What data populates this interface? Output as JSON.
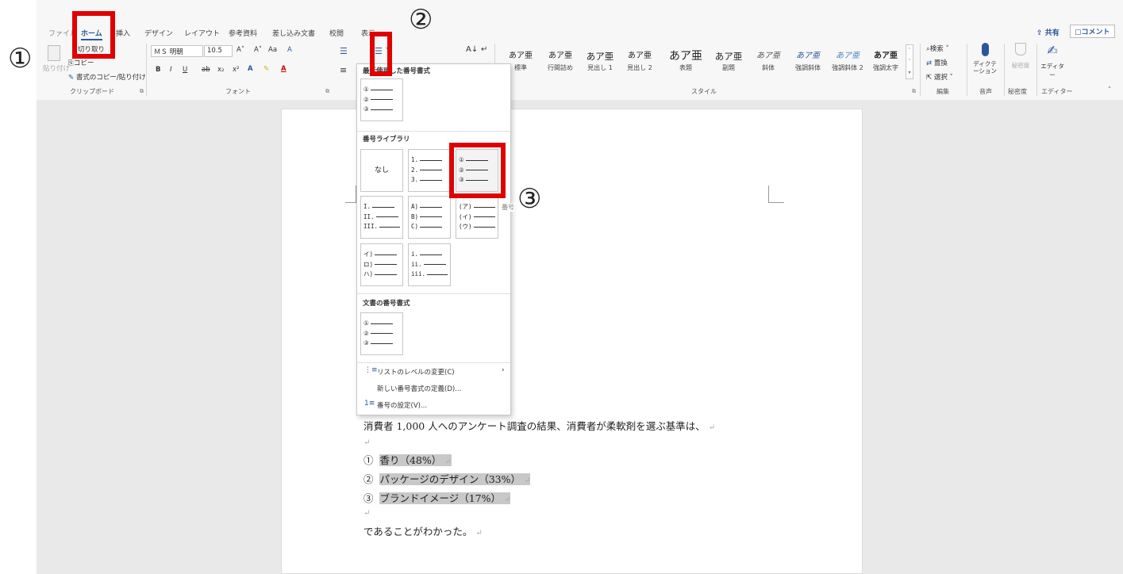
{
  "ribbon": {
    "tabs": [
      "ファイル",
      "ホーム",
      "挿入",
      "デザイン",
      "レイアウト",
      "参考資料",
      "差し込み文書",
      "校閲",
      "表示"
    ],
    "clipboard": {
      "paste": "貼り付け",
      "cut": "切り取り",
      "copy": "コピー",
      "format_painter": "書式のコピー/貼り付け",
      "label": "クリップボード"
    },
    "font": {
      "name": "ＭＳ 明朝",
      "size": "10.5",
      "label": "フォント",
      "grow": "A˄",
      "shrink": "A˅",
      "case": "Aa",
      "clear": "A",
      "bold": "B",
      "italic": "I",
      "underline": "U",
      "strike": "ab",
      "sub": "x₂",
      "sup": "x²"
    },
    "styles": {
      "items": [
        {
          "preview": "あア亜",
          "name": "標準"
        },
        {
          "preview": "あア亜",
          "name": "行間詰め"
        },
        {
          "preview": "あア亜",
          "name": "見出し 1"
        },
        {
          "preview": "あア亜",
          "name": "見出し 2"
        },
        {
          "preview": "あア亜",
          "name": "表題"
        },
        {
          "preview": "あア亜",
          "name": "副題"
        },
        {
          "preview": "あア亜",
          "name": "斜体"
        },
        {
          "preview": "あア亜",
          "name": "強調斜体"
        },
        {
          "preview": "あア亜",
          "name": "強調斜体 2"
        },
        {
          "preview": "あア亜",
          "name": "強調太字"
        }
      ],
      "label": "スタイル"
    },
    "editing": {
      "find": "検索",
      "replace": "置換",
      "select": "選択",
      "label": "編集"
    },
    "voice": {
      "dictate": "ディクテーション",
      "label": "音声"
    },
    "sensitivity": {
      "button": "秘密度",
      "label": "秘密度"
    },
    "editor": {
      "button": "エディター",
      "label": "エディター"
    },
    "share": "共有",
    "comment": "コメント"
  },
  "dropdown": {
    "recent_title": "最近使用した番号書式",
    "library_title": "番号ライブラリ",
    "doc_title": "文書の番号書式",
    "none": "なし",
    "recent": [
      "①",
      "②",
      "③"
    ],
    "library": [
      [
        "1.",
        "2.",
        "3."
      ],
      [
        "①",
        "②",
        "③"
      ],
      [
        "I.",
        "II.",
        "III."
      ],
      [
        "A)",
        "B)",
        "C)"
      ],
      [
        "(ア)",
        "(イ)",
        "(ウ)"
      ],
      [
        "イ)",
        "ロ)",
        "ハ)"
      ],
      [
        "i.",
        "ii.",
        "iii."
      ]
    ],
    "doc": [
      "①",
      "②",
      "③"
    ],
    "menu_change_level": "リストのレベルの変更(C)",
    "menu_define": "新しい番号書式の定義(D)...",
    "menu_set_value": "番号の設定(V)..."
  },
  "document": {
    "intro": "消費者 1,000 人へのアンケート調査の結果、消費者が柔軟剤を選ぶ基準は、",
    "para_mark": "↵",
    "items": [
      {
        "num": "①",
        "text": "香り（48%）"
      },
      {
        "num": "②",
        "text": "パッケージのデザイン（33%）"
      },
      {
        "num": "③",
        "text": "ブランドイメージ（17%）"
      }
    ],
    "closing": "であることがわかった。"
  },
  "annotations": [
    "①",
    "②",
    "③"
  ],
  "colors": {
    "accent": "#2b579a",
    "highlight": "#e00000",
    "selection": "#c8c8c8"
  }
}
